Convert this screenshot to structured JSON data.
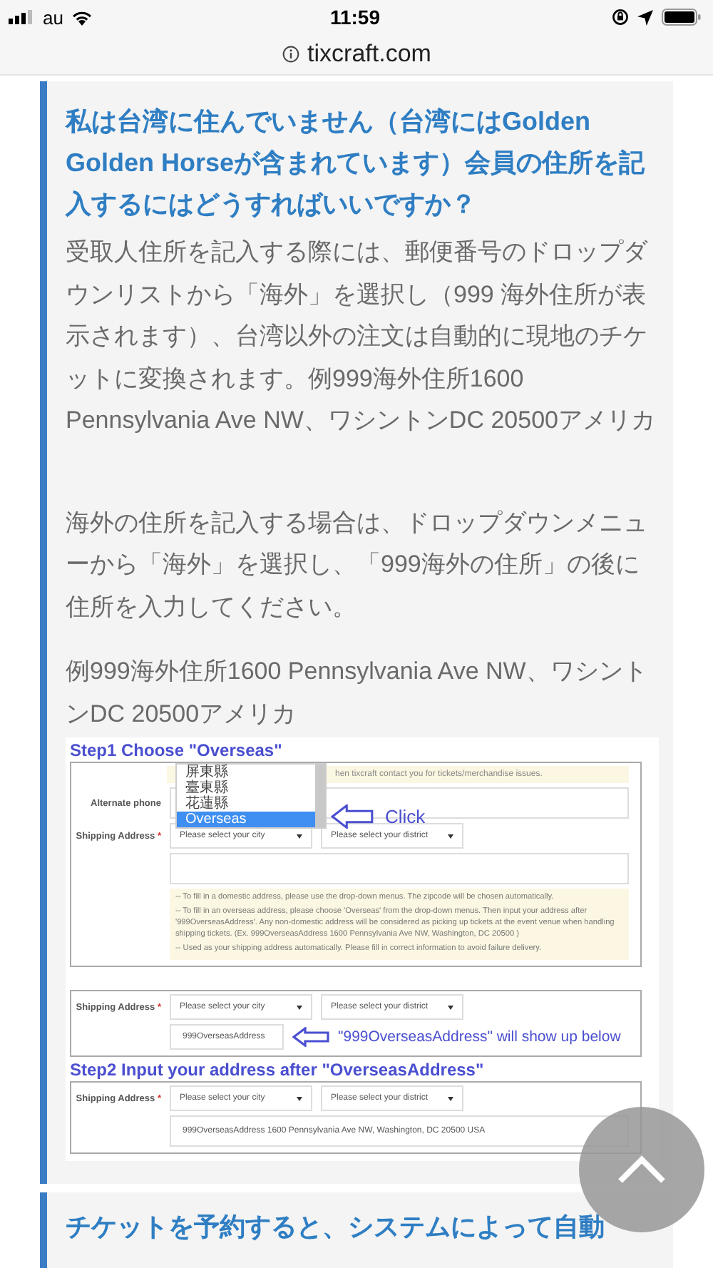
{
  "status_bar": {
    "carrier": "au",
    "time": "11:59"
  },
  "url_bar": {
    "domain": "tixcraft.com"
  },
  "faq": [
    {
      "title": "私は台湾に住んでいません（台湾にはGolden Golden Horseが含まれています）会員の住所を記入するにはどうすればいいですか？",
      "paragraphs": [
        "受取人住所を記入する際には、郵便番号のドロップダウンリストから「海外」を選択し（999 海外住所が表示されます）、台湾以外の注文は自動的に現地のチケットに変換されます。例999海外住所1600 Pennsylvania Ave NW、ワシントンDC 20500アメリカ",
        "海外の住所を記入する場合は、ドロップダウンメニューから「海外」を選択し、「999海外の住所」の後に住所を入力してください。",
        "例999海外住所1600 Pennsylvania Ave NW、ワシントンDC 20500アメリカ"
      ],
      "figure": {
        "step1_caption": "Step1 Choose \"Overseas\"",
        "panel1": {
          "notice": "hen tixcraft contact you for tickets/merchandise issues.",
          "alternate_phone_label": "Alternate phone",
          "shipping_label": "Shipping Address",
          "required_mark": "*",
          "city_select": "Please select your city",
          "district_select": "Please select your district",
          "dropdown_options": [
            {
              "label": "屏東縣",
              "selected": false
            },
            {
              "label": "臺東縣",
              "selected": false
            },
            {
              "label": "花蓮縣",
              "selected": false
            },
            {
              "label": "Overseas",
              "selected": true
            }
          ],
          "callout": "Click",
          "hints": [
            "-- To fill in a domestic address, please use the drop-down menus. The zipcode will be chosen automatically.",
            "-- To fill in an overseas address, please choose 'Overseas' from the drop-down menus. Then input your address after '999OverseasAddress'. Any non-domestic address will be considered as picking up tickets at the event venue when handling shipping tickets. (Ex. 999OverseasAddress 1600 Pennsylvania Ave NW, Washington, DC 20500 )",
            "-- Used as your shipping address automatically. Please fill in correct information to avoid failure delivery."
          ]
        },
        "panel2": {
          "shipping_label": "Shipping Address",
          "required_mark": "*",
          "city_select": "Please select your city",
          "district_select": "Please select your district",
          "address_value": "999OverseasAddress",
          "callout": "\"999OverseasAddress\" will show up below"
        },
        "step2_caption": "Step2 Input your address after \"OverseasAddress\"",
        "panel3": {
          "shipping_label": "Shipping Address",
          "required_mark": "*",
          "city_select": "Please select your city",
          "district_select": "Please select your district",
          "address_value": "999OverseasAddress 1600 Pennsylvania Ave NW, Washington, DC 20500 USA"
        }
      }
    },
    {
      "title": "チケットを予約すると、システムによって自動"
    }
  ]
}
